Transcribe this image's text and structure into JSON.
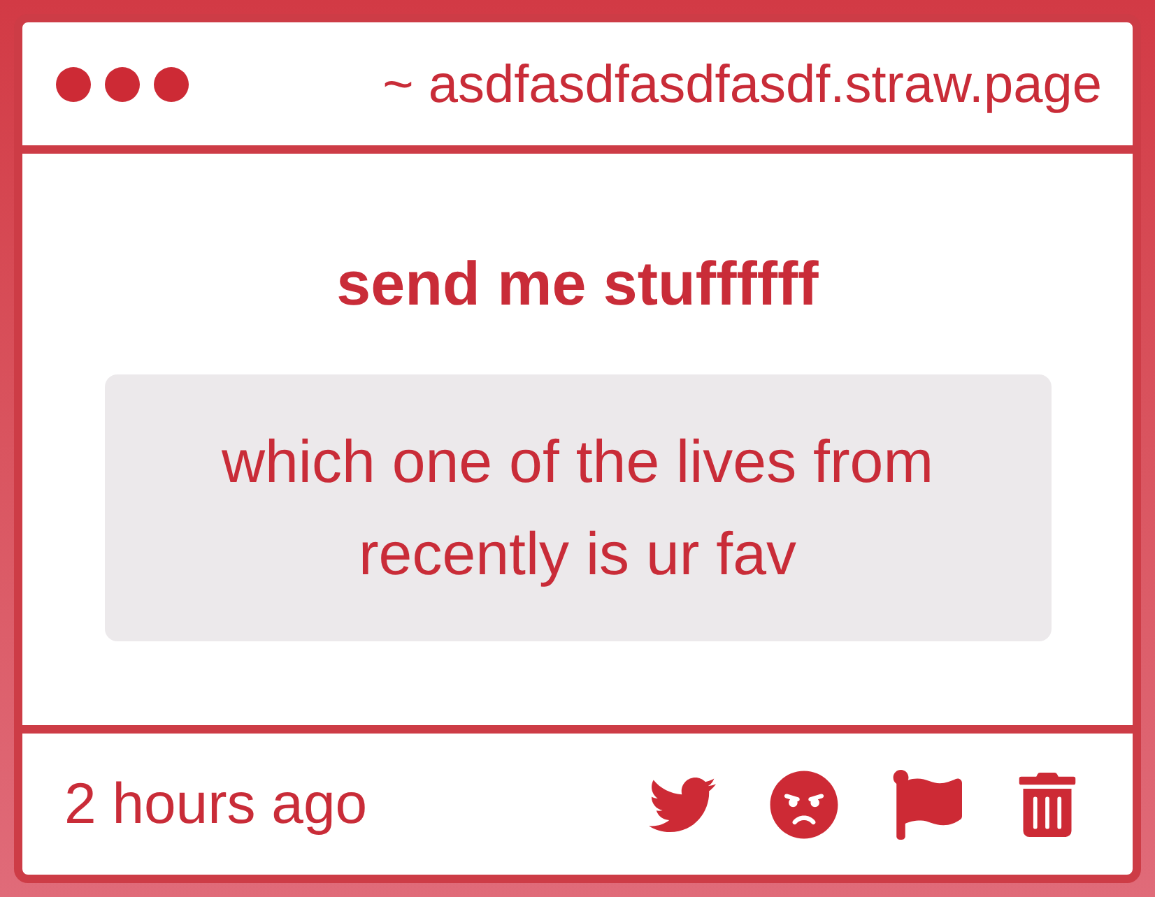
{
  "window": {
    "address": "~ asdfasdfasdfasdf.straw.page"
  },
  "page": {
    "title": "send me stuffffff",
    "question": "which one of the lives from recently is ur fav"
  },
  "footer": {
    "timestamp": "2 hours ago"
  }
}
